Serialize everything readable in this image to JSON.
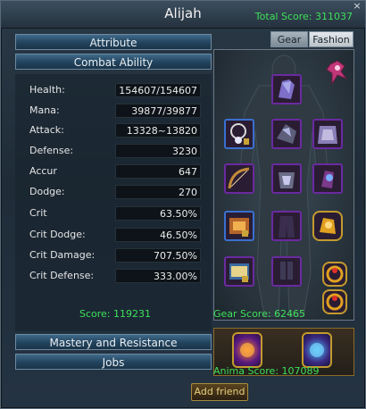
{
  "window": {
    "title": "Alijah",
    "total_score": "Total Score: 311037",
    "close_label": "×"
  },
  "tabs": [
    {
      "label": "Gear"
    },
    {
      "label": "Fashion"
    }
  ],
  "sections": {
    "attribute": "Attribute",
    "combat_ability": "Combat Ability",
    "mastery": "Mastery and Resistance",
    "jobs": "Jobs"
  },
  "stats": [
    {
      "label": "Health:",
      "value": "154607/154607"
    },
    {
      "label": "Mana:",
      "value": "39877/39877"
    },
    {
      "label": "Attack:",
      "value": "13328~13820"
    },
    {
      "label": "Defense:",
      "value": "3230"
    },
    {
      "label": "Accur",
      "value": "647"
    },
    {
      "label": "Dodge:",
      "value": "270"
    },
    {
      "label": "Crit",
      "value": "63.50%"
    },
    {
      "label": "Crit Dodge:",
      "value": "46.50%"
    },
    {
      "label": "Crit Damage:",
      "value": "707.50%"
    },
    {
      "label": "Crit Defense:",
      "value": "333.00%"
    }
  ],
  "scores": {
    "stats": "Score: 119231",
    "gear": "Gear Score: 62465",
    "anima": "Anima Score: 107089"
  },
  "buttons": {
    "add_friend": "Add friend"
  },
  "icons": [
    "close-icon",
    "pet-icon",
    "helmet-icon",
    "necklace-icon",
    "shoulder-armor-icon",
    "cape-icon",
    "bow-weapon-icon",
    "chest-armor-icon",
    "gloves-icon",
    "belt-icon",
    "pants-icon",
    "amulet-icon",
    "book-icon",
    "boots-icon",
    "ring-icon",
    "anima-icon"
  ],
  "colors": {
    "score_green": "#3ee05a",
    "slot_purple": "#6a2aa0",
    "slot_gold": "#c39a2e",
    "bar_blue": "#22435d"
  }
}
